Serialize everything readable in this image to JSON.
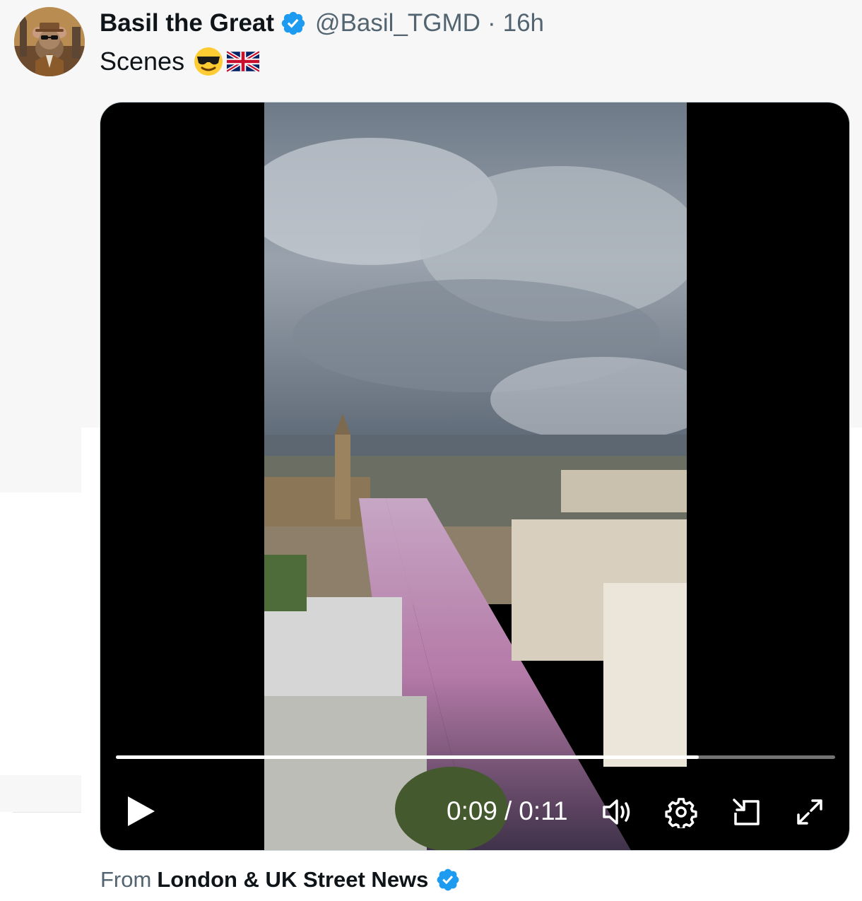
{
  "tweet": {
    "author_name": "Basil the Great",
    "handle": "@Basil_TGMD",
    "separator": "·",
    "time_ago": "16h",
    "text": "Scenes",
    "emojis": [
      "smiling-face-with-sunglasses",
      "uk-flag"
    ]
  },
  "video": {
    "current_time": "0:09",
    "time_separator": "/",
    "duration": "0:11",
    "progress": 0.81,
    "controls": [
      "play-icon",
      "volume-icon",
      "settings-icon",
      "picture-in-picture-icon",
      "fullscreen-icon"
    ]
  },
  "source": {
    "prefix": "From",
    "account": "London & UK Street News"
  },
  "colors": {
    "verified": "#1d9bf0",
    "secondary_text": "#536471",
    "primary_text": "#0f1419"
  }
}
